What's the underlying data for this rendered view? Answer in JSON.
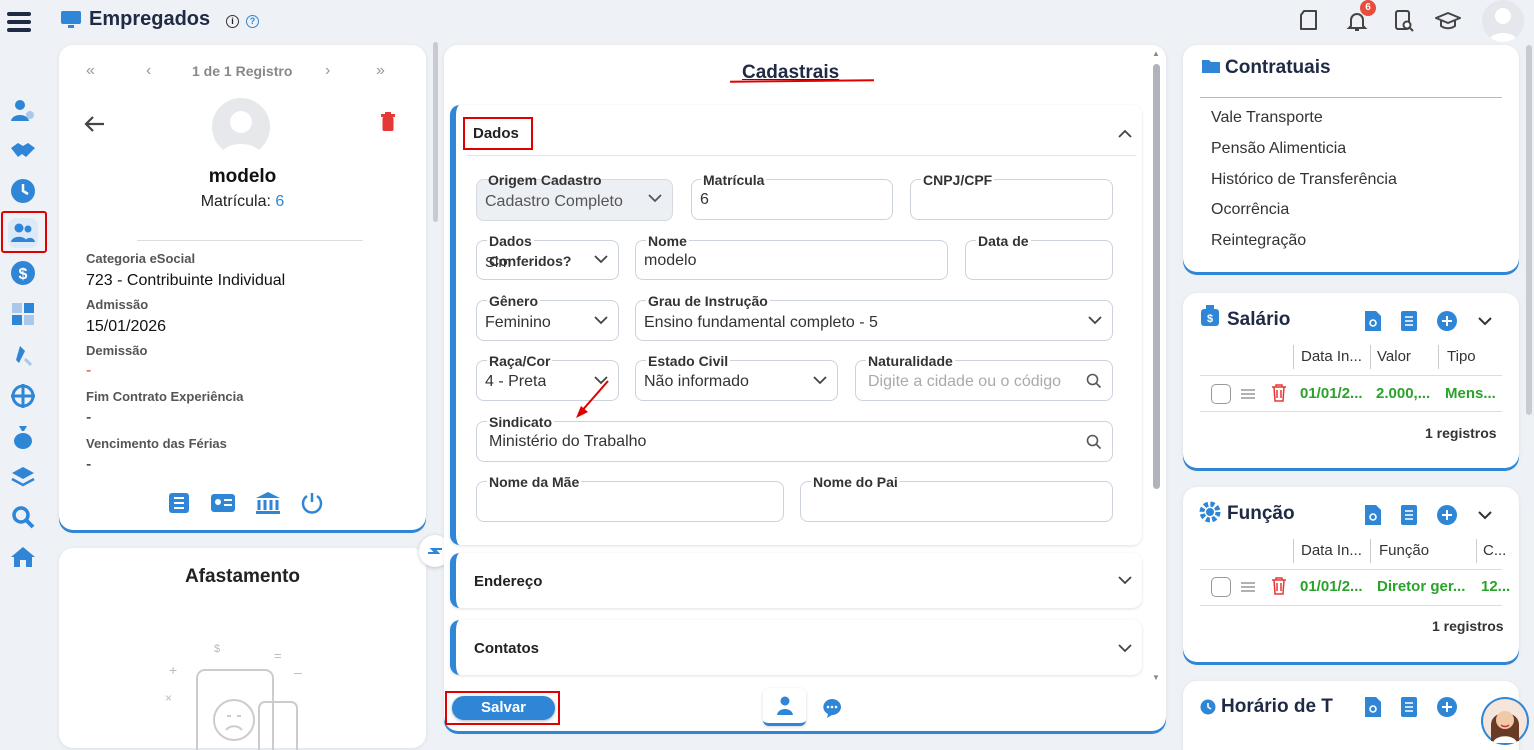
{
  "header": {
    "title": "Empregados",
    "notification_count": "6"
  },
  "employee_card": {
    "pager": "1 de 1 Registro",
    "name": "modelo",
    "matricula_label": "Matrícula:",
    "matricula_value": "6",
    "fields": [
      {
        "label": "Categoria eSocial",
        "value": "723 - Contribuinte Individual"
      },
      {
        "label": "Admissão",
        "value": "15/01/2026"
      },
      {
        "label": "Demissão",
        "value": "-"
      },
      {
        "label": "Fim Contrato Experiência",
        "value": "-"
      },
      {
        "label": "Vencimento das Férias",
        "value": "-"
      }
    ]
  },
  "afastamento": {
    "title": "Afastamento"
  },
  "main": {
    "title": "Cadastrais",
    "section_dados": "Dados",
    "section_endereco": "Endereço",
    "section_contatos": "Contatos",
    "save_label": "Salvar",
    "fields": {
      "origem_label": "Origem Cadastro",
      "origem_value": "Cadastro Completo",
      "matricula_label": "Matrícula",
      "matricula_value": "6",
      "cnpj_label": "CNPJ/CPF",
      "cnpj_value": "",
      "dados_conf_label_1": "Dados",
      "dados_conf_label_2": "Conferidos?",
      "dados_conf_value": "Sim",
      "nome_label": "Nome",
      "nome_value": "modelo",
      "data_label": "Data de",
      "data_value": "",
      "genero_label": "Gênero",
      "genero_value": "Feminino",
      "grau_label": "Grau de Instrução",
      "grau_value": "Ensino fundamental completo - 5",
      "raca_label": "Raça/Cor",
      "raca_value": "4 - Preta",
      "estado_civil_label": "Estado Civil",
      "estado_civil_value": "Não informado",
      "naturalidade_label": "Naturalidade",
      "naturalidade_placeholder": "Digite a cidade ou o código",
      "sindicato_label": "Sindicato",
      "sindicato_value": "Ministério do Trabalho",
      "mae_label": "Nome da Mãe",
      "pai_label": "Nome do Pai"
    }
  },
  "contratuais": {
    "title": "Contratuais",
    "items": [
      "Vale Transporte",
      "Pensão Alimenticia",
      "Histórico de Transferência",
      "Ocorrência",
      "Reintegração"
    ]
  },
  "salario": {
    "title": "Salário",
    "columns": [
      "Data In...",
      "Valor",
      "Tipo"
    ],
    "row": [
      "01/01/2...",
      "2.000,...",
      "Mens..."
    ],
    "count": "1 registros"
  },
  "funcao": {
    "title": "Função",
    "columns": [
      "Data In...",
      "Função",
      "C..."
    ],
    "row": [
      "01/01/2...",
      "Diretor ger...",
      "12..."
    ],
    "count": "1 registros"
  },
  "horario": {
    "title": "Horário de T"
  },
  "colors": {
    "accent": "#2f86d6",
    "danger": "#e53935",
    "success": "#2aa32a",
    "highlight": "#e00000"
  }
}
